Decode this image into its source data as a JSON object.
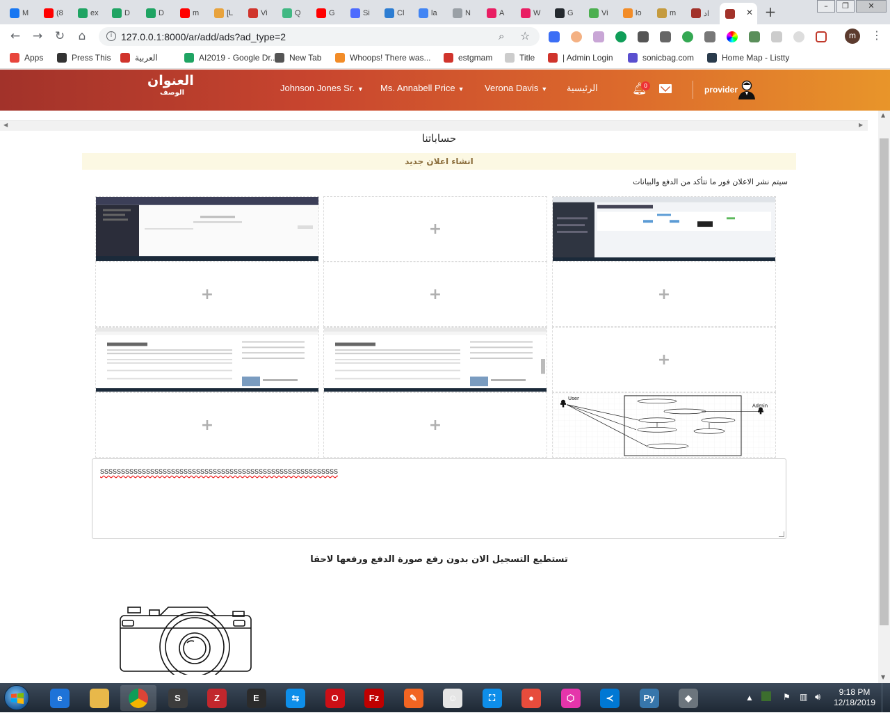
{
  "browser": {
    "tabs": [
      {
        "label": "M",
        "color": "#1877f2"
      },
      {
        "label": "(8",
        "color": "#ff0000"
      },
      {
        "label": "ex",
        "color": "#1fa463"
      },
      {
        "label": "D",
        "color": "#1fa463"
      },
      {
        "label": "D",
        "color": "#1fa463"
      },
      {
        "label": "m",
        "color": "#ff0000"
      },
      {
        "label": "[L",
        "color": "#e8a33d"
      },
      {
        "label": "Vi",
        "color": "#d0342c"
      },
      {
        "label": "Q",
        "color": "#41b883"
      },
      {
        "label": "G",
        "color": "#ff0000"
      },
      {
        "label": "Si",
        "color": "#4d6bfe"
      },
      {
        "label": "Cl",
        "color": "#2d7dd2"
      },
      {
        "label": "la",
        "color": "#4285f4"
      },
      {
        "label": "N",
        "color": "#9aa0a6"
      },
      {
        "label": "A",
        "color": "#e91e63"
      },
      {
        "label": "W",
        "color": "#e91e63"
      },
      {
        "label": "G",
        "color": "#24292e"
      },
      {
        "label": "Vi",
        "color": "#4caf50"
      },
      {
        "label": "lo",
        "color": "#f28c28"
      },
      {
        "label": "m",
        "color": "#c59b3f"
      },
      {
        "label": "اد",
        "color": "#a2322a"
      },
      {
        "label": "",
        "color": "#a2322a"
      }
    ],
    "url": "127.0.0.1:8000/ar/add/ads?ad_type=2",
    "profile_initial": "m",
    "bookmarks": [
      {
        "label": "Apps",
        "color": "#e8453c"
      },
      {
        "label": "Press This",
        "color": "#333333"
      },
      {
        "label": "العربية",
        "color": "#d0342c"
      },
      {
        "label": "AI2019 - Google Dr...",
        "color": "#1fa463"
      },
      {
        "label": "New Tab",
        "color": "#555555"
      },
      {
        "label": "Whoops! There was...",
        "color": "#f28c28"
      },
      {
        "label": "estgmam",
        "color": "#d0342c"
      },
      {
        "label": "Title",
        "color": "#cccccc"
      },
      {
        "label": "| Admin Login",
        "color": "#d0342c"
      },
      {
        "label": "sonicbag.com",
        "color": "#5a4fcf"
      },
      {
        "label": "Home Map - Listty",
        "color": "#2a3b4c"
      }
    ]
  },
  "site": {
    "logo_title": "العنوان",
    "logo_subtitle": "الوصف",
    "nav": [
      {
        "label": "Johnson Jones Sr."
      },
      {
        "label": "Ms. Annabell Price"
      },
      {
        "label": "Verona Davis"
      },
      {
        "label": "الرئيسية"
      }
    ],
    "notification_count": "0",
    "user_label": "provider"
  },
  "content": {
    "page_title": "حساباتنا",
    "alert": "انشاء اعلان جديد",
    "notice": "سيتم نشر الاعلان فور ما تتأكد من الدفع والبيانات",
    "upload_plus": "+",
    "textarea_value": "sssssssssssssssssssssssssssssssssssssssssssssssssssssssss",
    "later_note": "تستطيع التسجيل الان بدون رفع صورة الدفع ورفعها لاحقا",
    "use_case": {
      "actor_left": "User",
      "actor_right": "Admin"
    }
  },
  "taskbar": {
    "time": "9:18 PM",
    "date": "12/18/2019"
  }
}
